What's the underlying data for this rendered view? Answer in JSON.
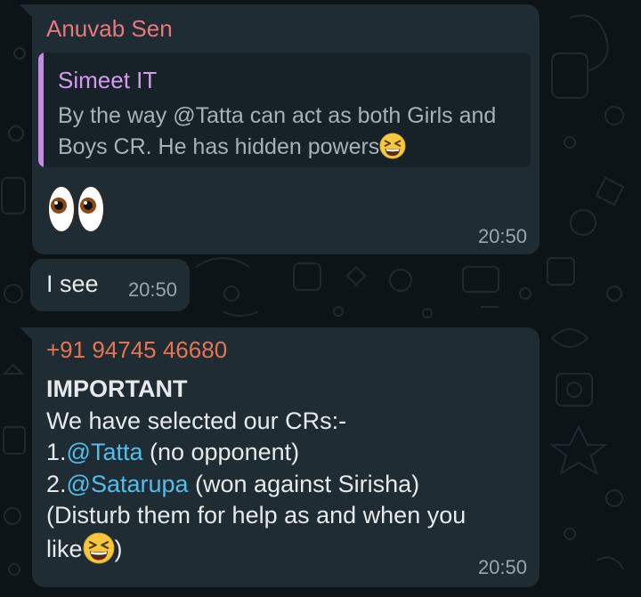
{
  "colors": {
    "bubble": "#1f2c34",
    "sender_1": "#e8787c",
    "sender_2": "#e8744f",
    "quote_author": "#d49aee",
    "quote_bar": "#c88ae0",
    "mention": "#53bdeb",
    "timestamp": "#99a6ae",
    "text": "#e6eaec"
  },
  "messages": [
    {
      "sender": "Anuvab Sen",
      "quote": {
        "author": "Simeet IT",
        "text": "By the way @Tatta can act as both Girls and Boys CR. He has hidden powers",
        "emoji": "grinning-squinting-face-icon"
      },
      "emoji": "eyes-icon",
      "time": "20:50"
    },
    {
      "text": "I see",
      "time": "20:50"
    },
    {
      "sender": "+91 94745 46680",
      "heading": "IMPORTANT",
      "line1": "We have selected our CRs:-",
      "line2_prefix": "1.",
      "line2_mention": "@Tatta",
      "line2_rest": " (no opponent)",
      "line3_prefix": "2.",
      "line3_mention": "@Satarupa",
      "line3_rest": " (won against Sirisha)",
      "line4": "(Disturb them for help as and when you",
      "line5_prefix": "like",
      "line5_suffix": ")",
      "emoji": "grinning-squinting-face-icon",
      "time": "20:50"
    }
  ]
}
